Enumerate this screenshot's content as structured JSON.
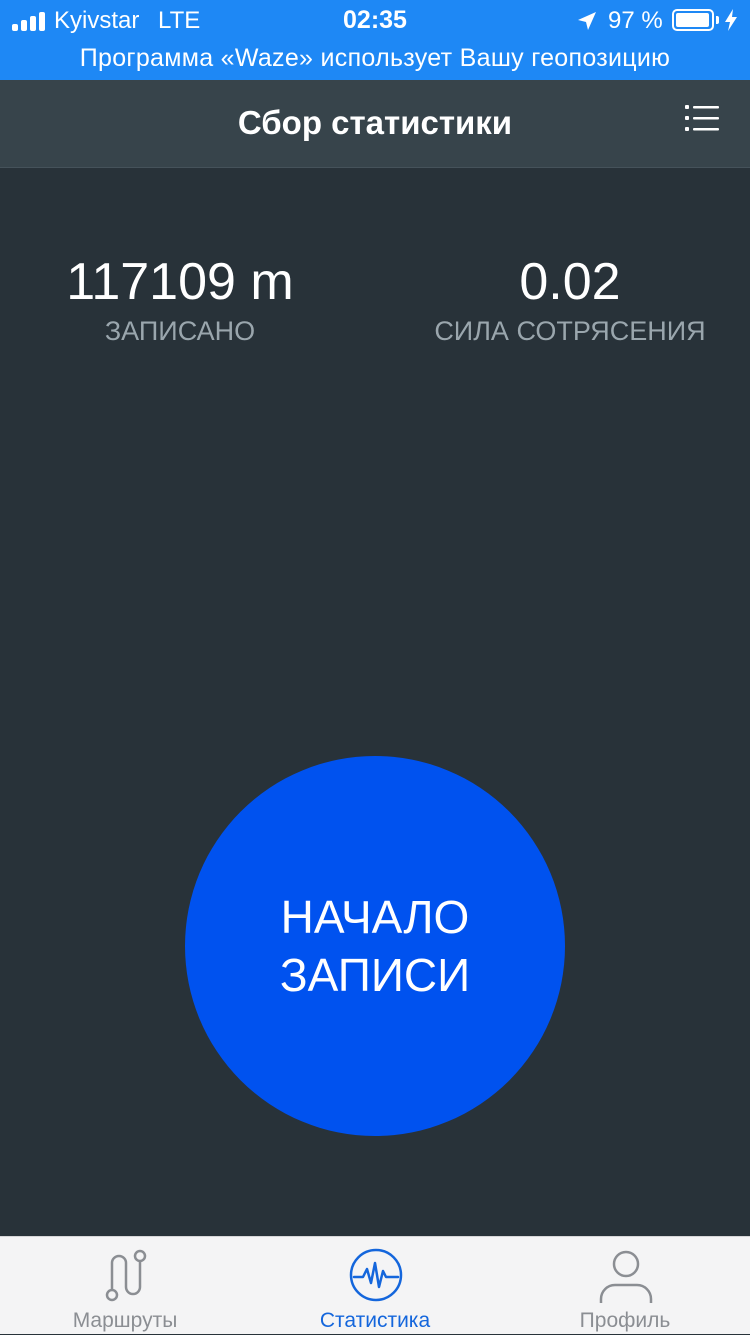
{
  "status_bar": {
    "carrier": "Kyivstar",
    "network": "LTE",
    "time": "02:35",
    "battery_percent": "97 %",
    "battery_level": 0.97,
    "location_banner": "Программа «Waze» использует Вашу геопозицию"
  },
  "header": {
    "title": "Сбор статистики",
    "menu_icon": "list-icon"
  },
  "stats": {
    "recorded": {
      "value": "117109 m",
      "label": "ЗАПИСАНО"
    },
    "shake": {
      "value": "0.02",
      "label": "СИЛА СОТРЯСЕНИЯ"
    }
  },
  "record_button": {
    "line1": "НАЧАЛО",
    "line2": "ЗАПИСИ"
  },
  "tabs": [
    {
      "label": "Маршруты",
      "icon": "routes-icon",
      "active": false
    },
    {
      "label": "Статистика",
      "icon": "waveform-icon",
      "active": true
    },
    {
      "label": "Профиль",
      "icon": "profile-icon",
      "active": false
    }
  ],
  "colors": {
    "status_bar": "#1e88f5",
    "background": "#283239",
    "nav_bar": "#37444b",
    "record_button": "#0052ef",
    "tab_active": "#1466dc",
    "tab_inactive": "#8b8e93"
  }
}
